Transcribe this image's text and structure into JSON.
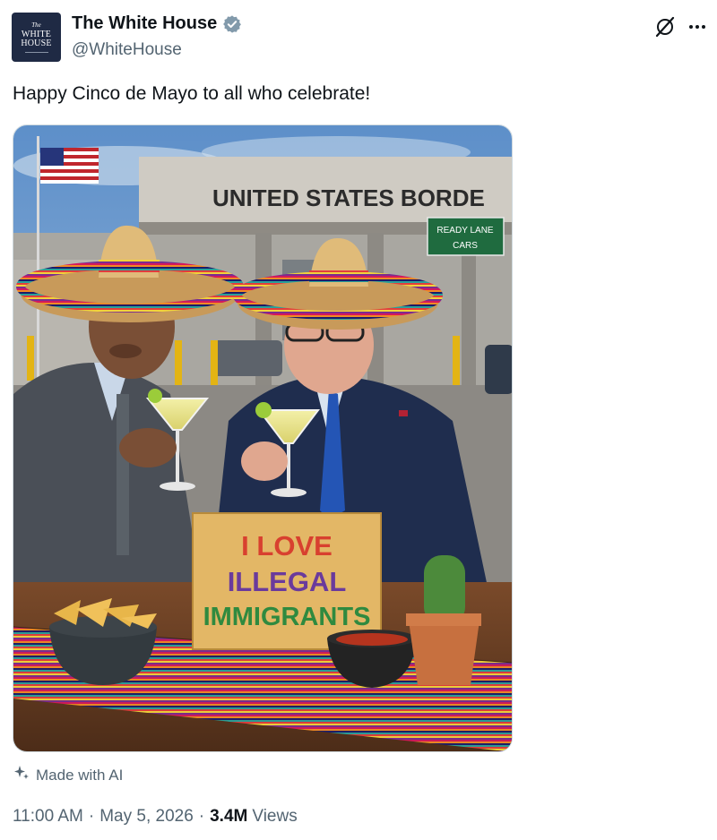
{
  "author": {
    "display_name": "The White House",
    "handle": "@WhiteHouse",
    "avatar": {
      "line1": "The",
      "line2": "WHITE",
      "line3": "HOUSE"
    }
  },
  "icons": {
    "verified": "verified-badge-icon",
    "grok": "grok-icon",
    "more": "more-options-icon",
    "sparkle": "sparkle-icon"
  },
  "tweet": {
    "text": "Happy Cinco de Mayo to all who celebrate!",
    "ai_label": "Made with AI",
    "time": "11:00 AM",
    "separator": "·",
    "date": "May 5, 2026",
    "views_count": "3.4M",
    "views_label": "Views"
  },
  "image": {
    "building_sign": "UNITED STATES BORDE",
    "ready_lane_line1": "READY LANE",
    "ready_lane_line2": "CARS",
    "sign_line1": "I LOVE",
    "sign_line2": "ILLEGAL",
    "sign_line3": "IMMIGRANTS"
  },
  "colors": {
    "text_primary": "#0f1419",
    "text_secondary": "#536471",
    "verified_badge": "#829aab",
    "border": "#cfd9de"
  }
}
